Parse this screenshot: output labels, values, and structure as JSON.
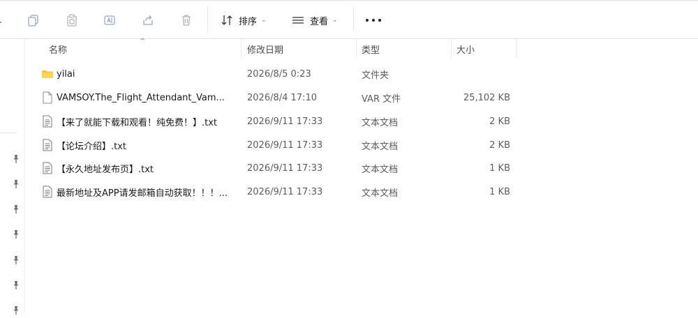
{
  "toolbar": {
    "sort_label": "排序",
    "view_label": "查看",
    "chevron": "⌄",
    "icons": [
      "copy-icon",
      "paste-icon",
      "rename-icon",
      "share-icon",
      "delete-icon",
      "sort-icon",
      "view-icon",
      "more-icon"
    ]
  },
  "columns": {
    "name": "名称",
    "date": "修改日期",
    "type": "类型",
    "size": "大小",
    "sort_indicator": "^"
  },
  "files": [
    {
      "icon": "folder-icon",
      "name": "yilai",
      "date": "2026/8/5 0:23",
      "type": "文件夹",
      "size": ""
    },
    {
      "icon": "file-icon",
      "name": "VAMSOY.The_Flight_Attendant_Vam...",
      "date": "2026/8/4 17:10",
      "type": "VAR 文件",
      "size": "25,102 KB"
    },
    {
      "icon": "text-file-icon",
      "name": "【来了就能下载和观看！纯免费！】.txt",
      "date": "2026/9/11 17:33",
      "type": "文本文档",
      "size": "2 KB"
    },
    {
      "icon": "text-file-icon",
      "name": "【论坛介绍】.txt",
      "date": "2026/9/11 17:33",
      "type": "文本文档",
      "size": "2 KB"
    },
    {
      "icon": "text-file-icon",
      "name": "【永久地址发布页】.txt",
      "date": "2026/9/11 17:33",
      "type": "文本文档",
      "size": "1 KB"
    },
    {
      "icon": "text-file-icon",
      "name": "最新地址及APP请发邮箱自动获取！！！...",
      "date": "2026/9/11 17:33",
      "type": "文本文档",
      "size": "1 KB"
    }
  ],
  "colors": {
    "folder": "#f5c242",
    "icon_gray": "#9a9a9a",
    "text_muted": "#5c5c5c"
  }
}
